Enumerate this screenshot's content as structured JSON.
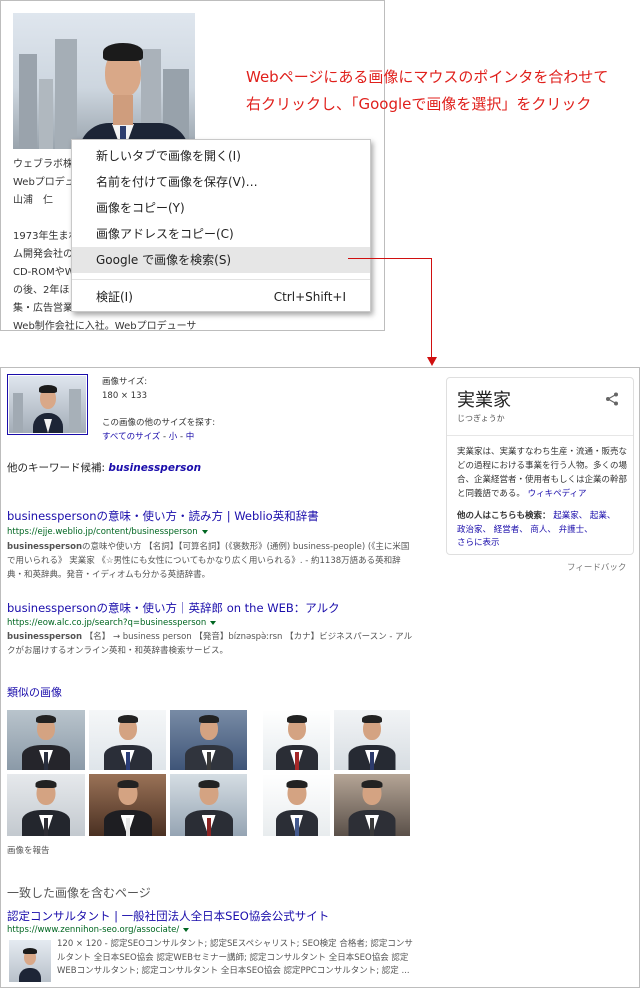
{
  "annotation": {
    "line1": "Webページにある画像にマウスのポインタを合わせて",
    "line2": "右クリックし、「Googleで画像を選択」をクリック"
  },
  "article": {
    "lines": [
      "ウェブラボ株",
      "Webプロデュ",
      "山浦　仁",
      "",
      "1973年生まれ",
      "ム開発会社の",
      "CD-ROMやW",
      "の後、2年ほ",
      "集・広告営業",
      "Web制作会社に入社。Webプロデューサ"
    ]
  },
  "context_menu": {
    "items": [
      {
        "label": "新しいタブで画像を開く(I)"
      },
      {
        "label": "名前を付けて画像を保存(V)…"
      },
      {
        "label": "画像をコピー(Y)"
      },
      {
        "label": "画像アドレスをコピー(C)"
      },
      {
        "label": "Google で画像を検索(S)"
      }
    ],
    "inspect": {
      "label": "検証(I)",
      "shortcut": "Ctrl+Shift+I"
    }
  },
  "search": {
    "image_size_label": "画像サイズ:",
    "image_size_value": "180 × 133",
    "other_sizes_label": "この画像の他のサイズを探す:",
    "all_sizes": "すべてのサイズ",
    "small": "小",
    "medium": "中",
    "sep": " - ",
    "keyword_label": "他のキーワード候補: ",
    "keyword": "businessperson",
    "results": [
      {
        "title": "businesspersonの意味・使い方・読み方 | Weblio英和辞書",
        "url": "https://ejje.weblio.jp/content/businessperson",
        "snippet_bold": "businessperson",
        "snippet": "の意味や使い方 【名詞】【可算名詞】(《褒数形》(通例) business-people) (《主に米国で用いられる》 実業家 《☆男性にも女性についてもかなり広く用いられる》. - 約1138万語ある英和辞典・和英辞典。発音・イディオムも分かる英語辞書。"
      },
      {
        "title": "businesspersonの意味・使い方｜英辞郎 on the WEB：アルク",
        "url": "https://eow.alc.co.jp/search?q=businessperson",
        "snippet_bold": "businessperson",
        "snippet": " 【名】 → business person 【発音】bíznəspə̀ːrsn 【カナ】ビジネスパースン - アルクがお届けするオンライン英和・和英辞書検索サービス。"
      }
    ],
    "similar_images_heading": "類似の画像",
    "report_images": "画像を報告",
    "matching_pages_heading": "一致した画像を含むページ",
    "match": {
      "title": "認定コンサルタント | 一般社団法人全日本SEO協会公式サイト",
      "url": "https://www.zennihon-seo.org/associate/",
      "snippet": "120 × 120 - 認定SEOコンサルタント; 認定SEスペシャリスト; SEO検定 合格者; 認定コンサルタント 全日本SEO協会 認定WEBセミナー講師; 認定コンサルタント 全日本SEO協会 認定WEBコンサルタント; 認定コンサルタント 全日本SEO協会 認定PPCコンサルタント; 認定 ..."
    }
  },
  "knowledge_panel": {
    "title": "実業家",
    "reading": "じつぎょうか",
    "description": "実業家は、実業すなわち生産・流通・販売などの過程における事業を行う人物。多くの場合、企業経営者・使用者もしくは企業の幹部と同義語である。",
    "wikipedia": "ウィキペディア",
    "see_also_label": "他の人はこちらも検索：",
    "see_also_line1": "起業家、 起業、",
    "see_also_line2": "政治家、 経営者、 商人、 弁護士、",
    "show_more": "さらに表示",
    "feedback": "フィードバック"
  }
}
